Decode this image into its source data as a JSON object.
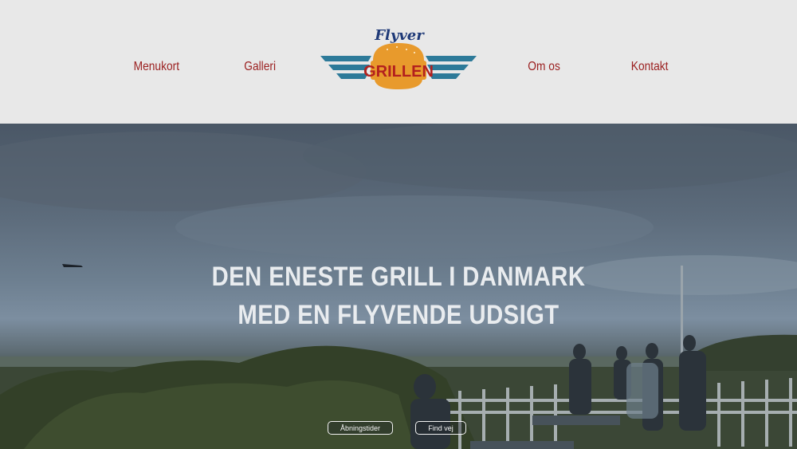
{
  "header": {
    "nav_left": [
      {
        "label": "Menukort"
      },
      {
        "label": "Galleri"
      }
    ],
    "nav_right": [
      {
        "label": "Om os"
      },
      {
        "label": "Kontakt"
      }
    ],
    "logo": {
      "top_text": "Flyver",
      "main_text": "GRILLEN",
      "colors": {
        "script": "#1f3a78",
        "bun": "#e89a2c",
        "text": "#b3201e",
        "wings": "#2d7a99"
      }
    }
  },
  "hero": {
    "headline_line1": "DEN ENESTE GRILL I DANMARK",
    "headline_line2": "MED EN FLYVENDE UDSIGT",
    "buttons": [
      {
        "label": "Åbningstider"
      },
      {
        "label": "Find vej"
      }
    ]
  },
  "colors": {
    "header_bg": "#e8e8e8",
    "nav_text": "#9a1e1e",
    "headline_text": "#e9ecef"
  }
}
